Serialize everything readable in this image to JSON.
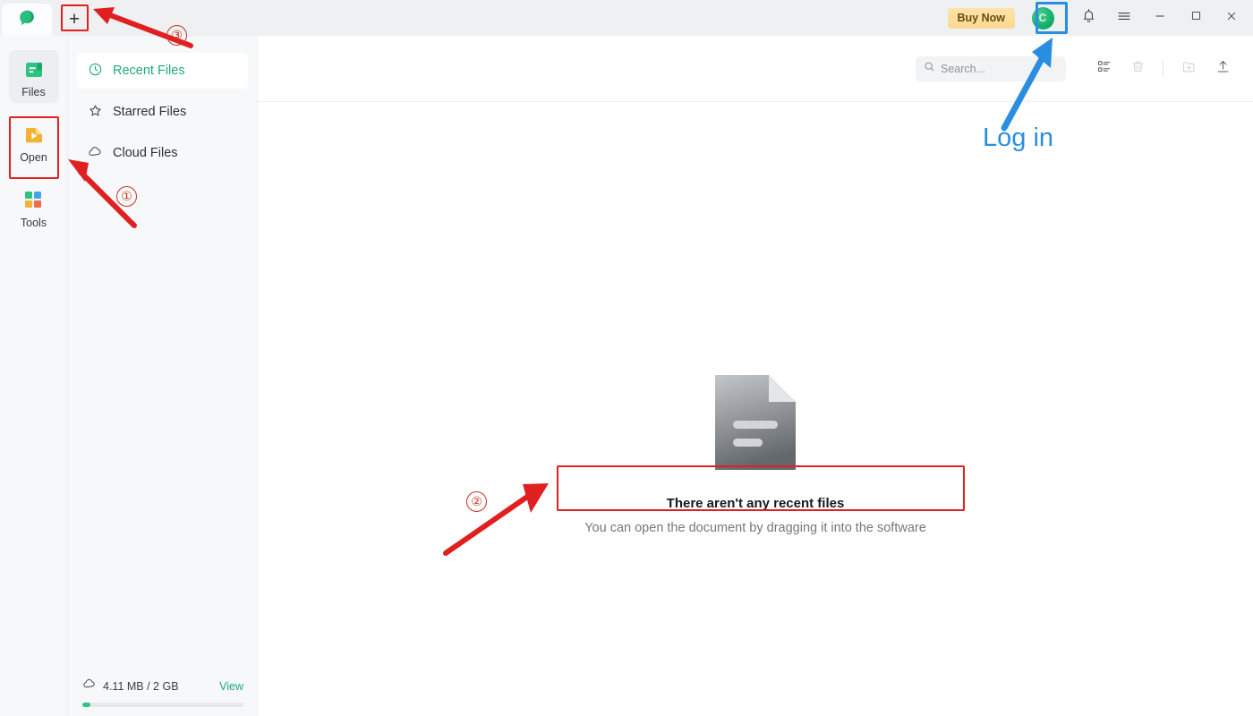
{
  "titlebar": {
    "logo_icon": "app-logo-green-speech-bubble",
    "new_tab_label": "+",
    "buy_now_label": "Buy Now",
    "avatar_letter": "C",
    "bell_icon": "bell-icon",
    "menu_icon": "hamburger-menu-icon",
    "minimize_icon": "minimize-icon",
    "maximize_icon": "maximize-icon",
    "close_icon": "close-icon"
  },
  "rail": {
    "items": [
      {
        "label": "Files",
        "icon": "files-icon",
        "active": true
      },
      {
        "label": "Open",
        "icon": "open-folder-icon",
        "active": false
      },
      {
        "label": "Tools",
        "icon": "tools-grid-icon",
        "active": false
      }
    ]
  },
  "nav": {
    "items": [
      {
        "label": "Recent Files",
        "icon": "clock-icon",
        "active": true
      },
      {
        "label": "Starred Files",
        "icon": "star-icon",
        "active": false
      },
      {
        "label": "Cloud Files",
        "icon": "cloud-icon",
        "active": false
      }
    ]
  },
  "storage": {
    "icon": "cloud-icon",
    "text": "4.11 MB / 2 GB",
    "view_label": "View",
    "used_percent": 5
  },
  "toolbar": {
    "search_placeholder": "Search...",
    "search_icon": "search-icon",
    "icons": [
      {
        "name": "list-view-icon",
        "disabled": false
      },
      {
        "name": "trash-icon",
        "disabled": true
      },
      {
        "name": "new-folder-icon",
        "disabled": true
      },
      {
        "name": "upload-icon",
        "disabled": false
      }
    ]
  },
  "empty_state": {
    "illustration": "document-placeholder-icon",
    "title": "There aren't any recent files",
    "subtitle": "You can open the document by dragging it into the software"
  },
  "annotations": {
    "login_label": "Log in",
    "markers": [
      {
        "label": "①"
      },
      {
        "label": "②"
      },
      {
        "label": "③"
      }
    ],
    "colors": {
      "red": "#e02020",
      "blue": "#2a8ee0",
      "circle_red": "#c8321f"
    }
  }
}
